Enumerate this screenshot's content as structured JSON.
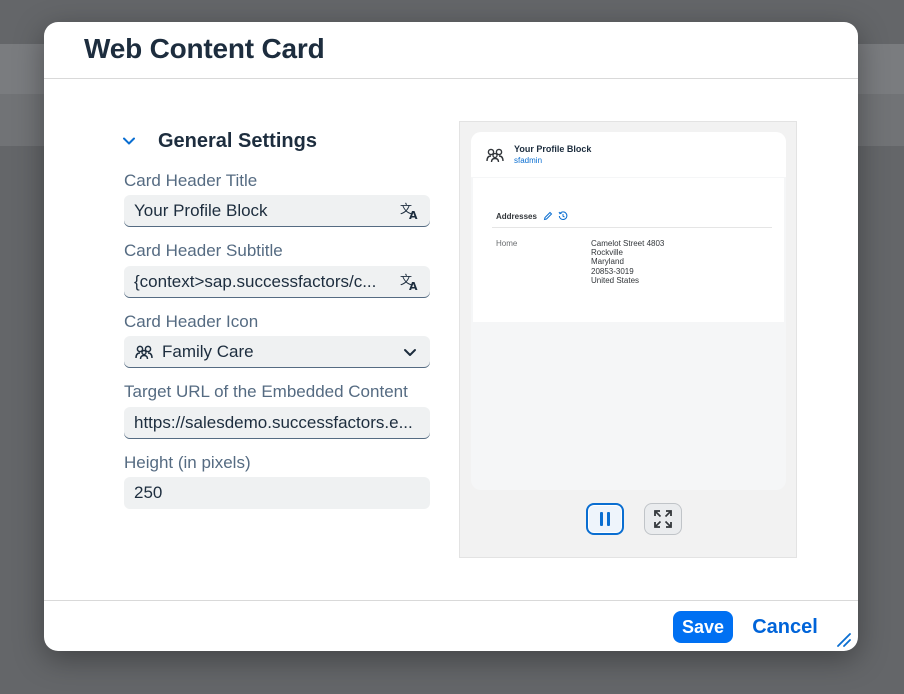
{
  "dialog": {
    "title": "Web Content Card",
    "section_title": "General Settings",
    "fields": {
      "header_title": {
        "label": "Card Header Title",
        "value": "Your Profile Block",
        "icon": "translate-icon"
      },
      "header_subtitle": {
        "label": "Card Header Subtitle",
        "value": "{context>sap.successfactors/c...",
        "icon": "translate-icon"
      },
      "header_icon": {
        "label": "Card Header Icon",
        "value": "Family Care",
        "icon": "family-care-icon"
      },
      "target_url": {
        "label": "Target URL of the Embedded Content",
        "value": "https://salesdemo.successfactors.e..."
      },
      "height": {
        "label": "Height (in pixels)",
        "value": "250"
      }
    },
    "footer": {
      "save_label": "Save",
      "cancel_label": "Cancel"
    }
  },
  "preview": {
    "card_title": "Your Profile Block",
    "card_subtitle": "sfadmin",
    "section": "Addresses",
    "address_label": "Home",
    "address_lines": [
      "Camelot Street 4803",
      "Rockville",
      "Maryland",
      "20853-3019",
      "United States"
    ]
  },
  "colors": {
    "accent": "#0070f2",
    "title_text": "#1d2d3e",
    "label_text": "#556b82",
    "field_bg": "#eff1f2"
  }
}
